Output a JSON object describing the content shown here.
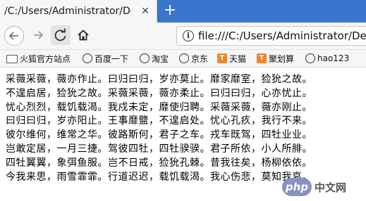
{
  "tab": {
    "title": "/C:/Users/Administrator/Desktop"
  },
  "newtab_label": "+",
  "urlbar": {
    "url": "file:///C:/Users/Administrator/Des"
  },
  "bookmarks": [
    {
      "label": "火狐官方站点",
      "icon": "folder-icon"
    },
    {
      "label": "百度一下",
      "icon": "globe-icon"
    },
    {
      "label": "淘宝",
      "icon": "globe-icon"
    },
    {
      "label": "京东",
      "icon": "globe-icon"
    },
    {
      "label": "天猫",
      "icon": "tmall-icon"
    },
    {
      "label": "聚划算",
      "icon": "tmall-icon"
    },
    {
      "label": "hao123",
      "icon": "globe-icon"
    }
  ],
  "content": {
    "lines": [
      "采薇采薇，薇亦作止。曰归曰归，岁亦莫止。靡家靡室，猃狁之故。",
      "不遑启居，猃狁之故。采薇采薇，薇亦柔止。曰归曰归，心亦忧止。",
      "忧心烈烈，载饥载渴。我戍未定，靡使归聘。采薇采薇，薇亦刚止。",
      "曰归曰归，岁亦阳止。王事靡盬，不遑启处。忧心孔疚，我行不来。",
      "彼尔维何，维常之华。彼路斯何，君子之车。戎车既驾，四牡业业。",
      "岂敢定居，一月三捷。驾彼四牡，四牡骙骙。君子所依，小人所腓。",
      "四牡翼翼，象弭鱼服。岂不日戒，猃狁孔棘。昔我往矣，杨柳依依。",
      "今我来思，雨雪霏霏。行道迟迟，载饥载渴。我心伤悲，莫知我哀。"
    ]
  },
  "watermark": {
    "logo": "php",
    "text": "中文网"
  },
  "colors": {
    "tabstrip": "#3a75ce",
    "toolbar": "#f5f6f7",
    "tmall_icon": "#f0862b"
  }
}
